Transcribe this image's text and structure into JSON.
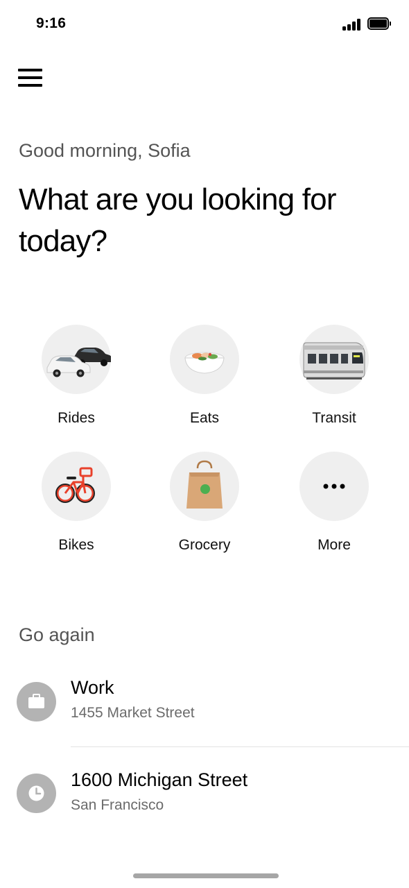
{
  "status_bar": {
    "time": "9:16",
    "signal_icon": "cellular-signal-icon",
    "battery_icon": "battery-icon"
  },
  "menu": {
    "icon": "hamburger-menu-icon"
  },
  "greeting": "Good morning, Sofia",
  "headline": "What are you looking for today?",
  "services": [
    {
      "label": "Rides",
      "icon": "car-icon"
    },
    {
      "label": "Eats",
      "icon": "food-bowl-icon"
    },
    {
      "label": "Transit",
      "icon": "train-icon"
    },
    {
      "label": "Bikes",
      "icon": "bike-icon"
    },
    {
      "label": "Grocery",
      "icon": "grocery-bag-icon"
    },
    {
      "label": "More",
      "icon": "more-dots-icon"
    }
  ],
  "go_again": {
    "title": "Go again",
    "places": [
      {
        "name": "Work",
        "address": "1455 Market Street",
        "icon": "briefcase-icon"
      },
      {
        "name": "1600 Michigan Street",
        "address": "San Francisco",
        "icon": "clock-icon"
      }
    ]
  },
  "colors": {
    "background": "#ffffff",
    "text": "#000000",
    "secondary_text": "#545454",
    "circle_bg": "#efefef",
    "pin_bg": "#b3b3b3"
  }
}
